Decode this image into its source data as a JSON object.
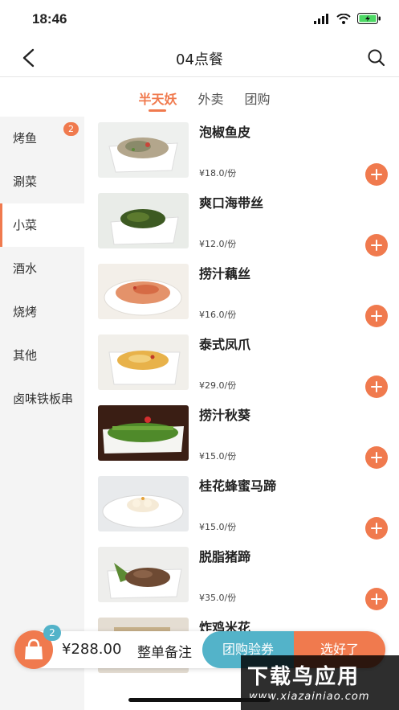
{
  "status_bar": {
    "time": "18:46"
  },
  "header": {
    "title": "04点餐"
  },
  "tabs": [
    {
      "label": "半天妖",
      "active": true
    },
    {
      "label": "外卖",
      "active": false
    },
    {
      "label": "团购",
      "active": false
    }
  ],
  "sidebar": {
    "items": [
      {
        "label": "烤鱼",
        "badge": "2",
        "active": false
      },
      {
        "label": "涮菜",
        "active": false
      },
      {
        "label": "小菜",
        "active": true
      },
      {
        "label": "酒水",
        "active": false
      },
      {
        "label": "烧烤",
        "active": false
      },
      {
        "label": "其他",
        "active": false
      },
      {
        "label": "卤味铁板串",
        "active": false
      }
    ]
  },
  "dishes": [
    {
      "name": "泡椒鱼皮",
      "price": "¥18.0/份"
    },
    {
      "name": "爽口海带丝",
      "price": "¥12.0/份"
    },
    {
      "name": "捞汁藕丝",
      "price": "¥16.0/份"
    },
    {
      "name": "泰式凤爪",
      "price": "¥29.0/份"
    },
    {
      "name": "捞汁秋葵",
      "price": "¥15.0/份"
    },
    {
      "name": "桂花蜂蜜马蹄",
      "price": "¥15.0/份"
    },
    {
      "name": "脱脂猪蹄",
      "price": "¥35.0/份"
    },
    {
      "name": "炸鸡米花",
      "price": ""
    }
  ],
  "cart": {
    "count": "2",
    "total": "¥288.00",
    "note_label": "整单备注",
    "coupon_label": "团购验券",
    "done_label": "选好了"
  },
  "watermark": {
    "title": "下载鸟应用",
    "url": "www.xiazainiao.com"
  },
  "colors": {
    "accent": "#f07a4e",
    "secondary": "#53b3c9"
  }
}
